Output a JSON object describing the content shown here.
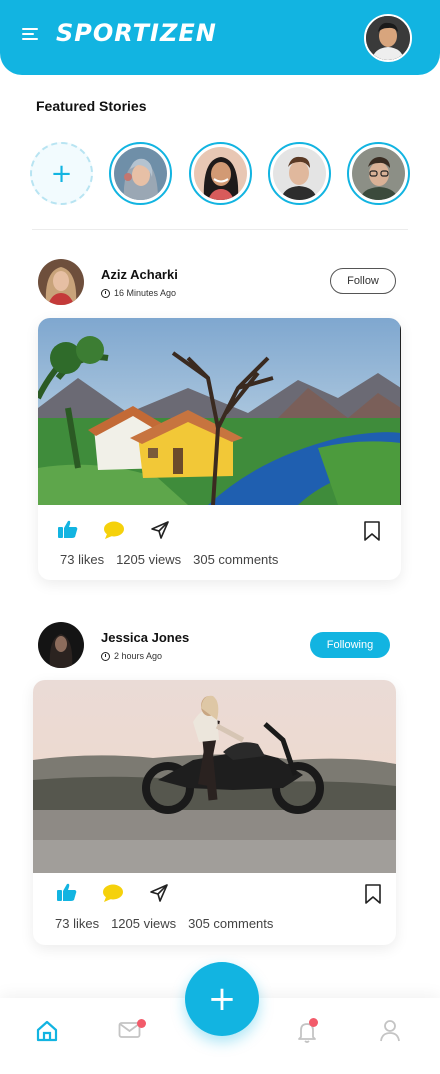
{
  "app": {
    "brand": "SPORTIZEN"
  },
  "stories": {
    "title": "Featured Stories",
    "add_symbol": "+",
    "items": [
      {
        "name": "story-1"
      },
      {
        "name": "story-2"
      },
      {
        "name": "story-3"
      },
      {
        "name": "story-4"
      }
    ]
  },
  "posts": [
    {
      "author": "Aziz Acharki",
      "time": "16 Minutes Ago",
      "follow_label": "Follow",
      "likes": "73 likes",
      "views": "1205 views",
      "comments": "305 comments"
    },
    {
      "author": "Jessica Jones",
      "time": "2 hours Ago",
      "follow_label": "Following",
      "likes": "73 likes",
      "views": "1205 views",
      "comments": "305 comments"
    }
  ],
  "nav": {
    "fab_symbol": "+"
  },
  "colors": {
    "accent": "#12b4e1",
    "like": "#12b4e1",
    "comment": "#f5d10b",
    "badge": "#f25b6a"
  }
}
